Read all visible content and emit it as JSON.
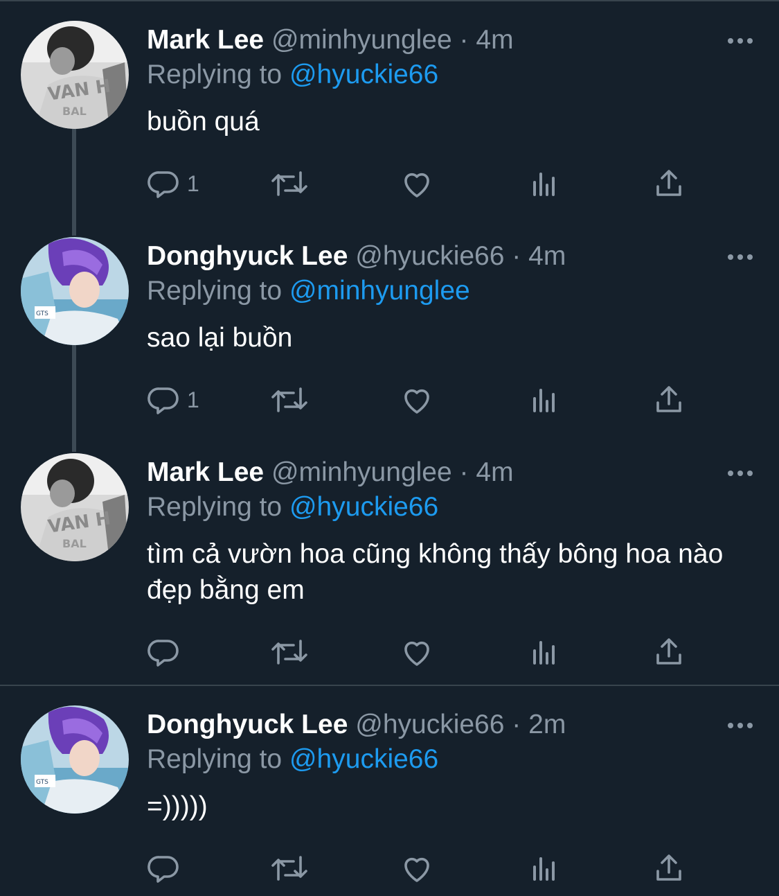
{
  "tweets": [
    {
      "name": "Mark Lee",
      "handle": "@minhyunglee",
      "separator": "·",
      "time": "4m",
      "replying_label": "Replying to",
      "replying_to": "@hyuckie66",
      "text": "buồn quá",
      "reply_count": "1",
      "avatar": "mark-lee-avatar"
    },
    {
      "name": "Donghyuck Lee",
      "handle": "@hyuckie66",
      "separator": "·",
      "time": "4m",
      "replying_label": "Replying to",
      "replying_to": "@minhyunglee",
      "text": "sao lại buồn",
      "reply_count": "1",
      "avatar": "donghyuck-lee-avatar"
    },
    {
      "name": "Mark Lee",
      "handle": "@minhyunglee",
      "separator": "·",
      "time": "4m",
      "replying_label": "Replying to",
      "replying_to": "@hyuckie66",
      "text": "tìm cả vườn hoa cũng không thấy bông hoa nào đẹp bằng em",
      "reply_count": "",
      "avatar": "mark-lee-avatar"
    },
    {
      "name": "Donghyuck Lee",
      "handle": "@hyuckie66",
      "separator": "·",
      "time": "2m",
      "replying_label": "Replying to",
      "replying_to": "@hyuckie66",
      "text": "=)))))",
      "reply_count": "",
      "avatar": "donghyuck-lee-avatar"
    }
  ],
  "icons": {
    "more": "more-horizontal-icon",
    "reply": "reply-icon",
    "retweet": "retweet-icon",
    "like": "heart-icon",
    "views": "views-chart-icon",
    "share": "share-icon"
  },
  "colors": {
    "background": "#15202b",
    "text_primary": "#ffffff",
    "text_secondary": "#8b98a5",
    "link": "#1d9bf0",
    "divider": "#38444d",
    "thread_line": "#3d4a55"
  }
}
